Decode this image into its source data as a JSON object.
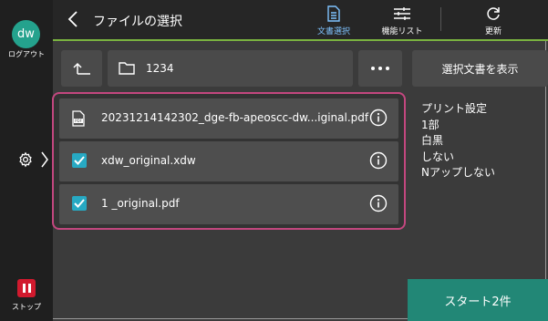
{
  "rail": {
    "avatar_text": "dw",
    "logout_label": "ログアウト",
    "settings_icon": "gear-icon",
    "expand_icon": "chevron-right-icon",
    "stop_label": "ストップ",
    "stop_color": "#d11a2e"
  },
  "header": {
    "title": "ファイルの選択",
    "buttons": [
      {
        "label": "文書選択",
        "icon": "document-icon",
        "active": true
      },
      {
        "label": "機能リスト",
        "icon": "sliders-icon",
        "active": false
      },
      {
        "label": "更新",
        "icon": "refresh-icon",
        "active": false
      }
    ],
    "accent_color": "#7ab340"
  },
  "path": {
    "folder_name": "1234",
    "up_icon": "up-level-icon",
    "more_icon": "more-icon"
  },
  "files": [
    {
      "name": "20231214142302_dge-fb-apeoscc-dw...iginal.pdf",
      "lead": "pdf-file-icon",
      "checked": false
    },
    {
      "name": "xdw_original.xdw",
      "lead": "checkbox",
      "checked": true
    },
    {
      "name": "1 _original.pdf",
      "lead": "checkbox",
      "checked": true
    }
  ],
  "right": {
    "show_selected_label": "選択文書を表示",
    "settings_title": "プリント設定",
    "settings": [
      "1部",
      "白黒",
      "しない",
      "Nアップしない"
    ],
    "start_label": "スタート2件",
    "start_color": "#228776"
  }
}
